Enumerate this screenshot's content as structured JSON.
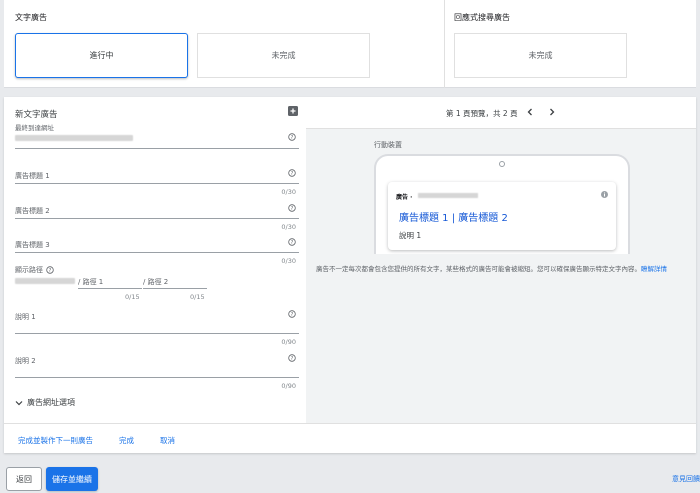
{
  "text_ad_section": {
    "title": "文字廣告",
    "in_progress": "進行中",
    "incomplete": "未完成"
  },
  "responsive_section": {
    "title": "回應式搜尋廣告",
    "incomplete": "未完成"
  },
  "form": {
    "title": "新文字廣告",
    "final_url_label": "最終到達網址",
    "headline1_label": "廣告標題 1",
    "headline1_count": "0/30",
    "headline2_label": "廣告標題 2",
    "headline2_count": "0/30",
    "headline3_label": "廣告標題 3",
    "headline3_count": "0/30",
    "display_path_label": "顯示路徑",
    "path1_placeholder": "/ 路徑 1",
    "path2_placeholder": "/ 路徑 2",
    "path1_count": "0/15",
    "path2_count": "0/15",
    "desc1_label": "說明 1",
    "desc1_count": "0/90",
    "desc2_label": "說明 2",
    "desc2_count": "0/90",
    "url_options_label": "廣告網址選項"
  },
  "preview": {
    "pager_text": "第 1 頁預覽，共 2 頁",
    "device_label": "行動裝置",
    "ad_label": "廣告 ·",
    "headline": "廣告標題 1 | 廣告標題 2",
    "description": "說明 1",
    "disclaimer": "廣告不一定每次都會包含您提供的所有文字，某些格式的廣告可能會被縮短。您可以確保廣告顯示特定文字內容。",
    "learn_more": "瞭解詳情"
  },
  "actions": {
    "done_next": "完成並製作下一則廣告",
    "done": "完成",
    "cancel": "取消"
  },
  "footer": {
    "back": "返回",
    "save_continue": "儲存並繼續",
    "feedback": "意見回饋"
  }
}
